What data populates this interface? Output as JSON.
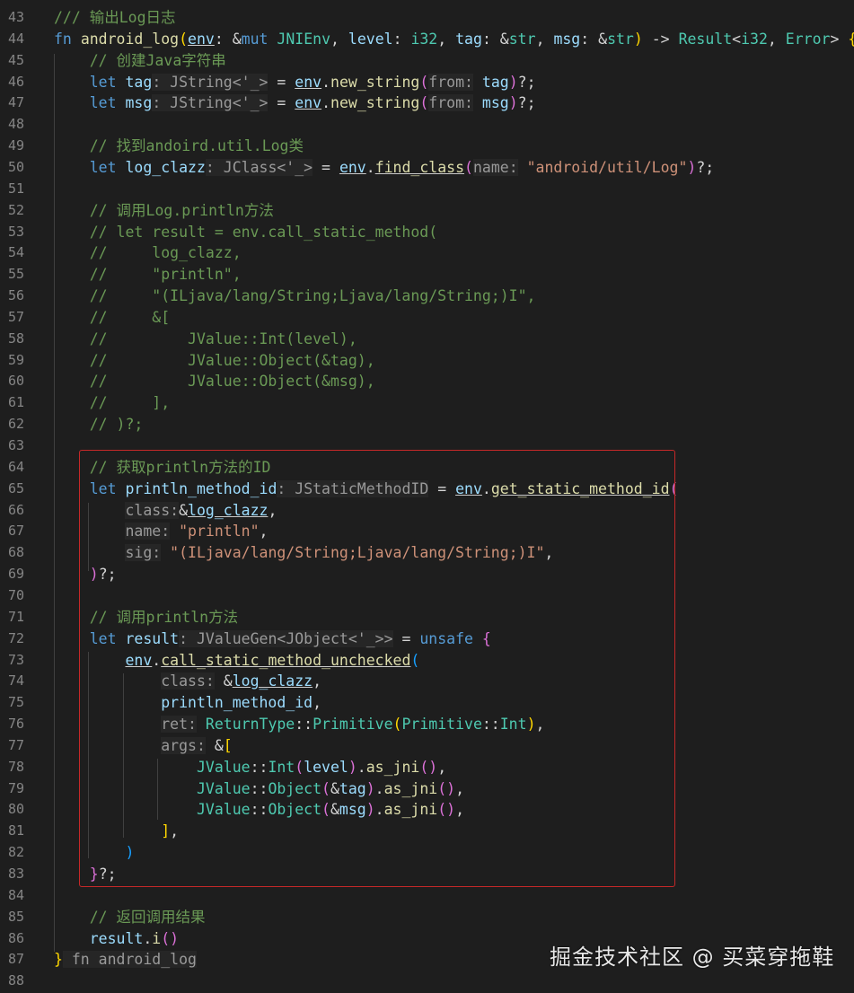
{
  "editor": {
    "lines": [
      {
        "n": "43",
        "parts": [
          [
            "cm",
            "/// 输出Log日志"
          ]
        ]
      },
      {
        "n": "44",
        "parts": [
          [
            "kw",
            "fn "
          ],
          [
            "fn",
            "android_log"
          ],
          [
            "br1",
            "("
          ],
          [
            "vr ul",
            "env"
          ],
          [
            "",
            ": &"
          ],
          [
            "kw",
            "mut "
          ],
          [
            "ty",
            "JNIEnv"
          ],
          [
            "",
            ", "
          ],
          [
            "vr",
            "level"
          ],
          [
            "",
            ": "
          ],
          [
            "ty",
            "i32"
          ],
          [
            "",
            ", "
          ],
          [
            "vr",
            "tag"
          ],
          [
            "",
            ": &"
          ],
          [
            "ty",
            "str"
          ],
          [
            "",
            ", "
          ],
          [
            "vr",
            "msg"
          ],
          [
            "",
            ": &"
          ],
          [
            "ty",
            "str"
          ],
          [
            "br1",
            ")"
          ],
          [
            "",
            " -> "
          ],
          [
            "ty",
            "Result"
          ],
          [
            "",
            "<"
          ],
          [
            "ty",
            "i32"
          ],
          [
            "",
            ", "
          ],
          [
            "ty",
            "Error"
          ],
          [
            "",
            "> "
          ],
          [
            "br1",
            "{"
          ]
        ]
      },
      {
        "n": "45",
        "parts": [
          [
            "",
            "    "
          ],
          [
            "cm",
            "// 创建Java字符串"
          ]
        ]
      },
      {
        "n": "46",
        "parts": [
          [
            "",
            "    "
          ],
          [
            "kw",
            "let "
          ],
          [
            "vr",
            "tag"
          ],
          [
            "hint",
            ": JString<'_>"
          ],
          [
            "",
            " = "
          ],
          [
            "vr ul",
            "env"
          ],
          [
            "",
            "."
          ],
          [
            "fn",
            "new_string"
          ],
          [
            "br2",
            "("
          ],
          [
            "hint",
            "from:"
          ],
          [
            "",
            " "
          ],
          [
            "vr",
            "tag"
          ],
          [
            "br2",
            ")"
          ],
          [
            "",
            "?;"
          ]
        ]
      },
      {
        "n": "47",
        "parts": [
          [
            "",
            "    "
          ],
          [
            "kw",
            "let "
          ],
          [
            "vr",
            "msg"
          ],
          [
            "hint",
            ": JString<'_>"
          ],
          [
            "",
            " = "
          ],
          [
            "vr ul",
            "env"
          ],
          [
            "",
            "."
          ],
          [
            "fn",
            "new_string"
          ],
          [
            "br2",
            "("
          ],
          [
            "hint",
            "from:"
          ],
          [
            "",
            " "
          ],
          [
            "vr",
            "msg"
          ],
          [
            "br2",
            ")"
          ],
          [
            "",
            "?;"
          ]
        ]
      },
      {
        "n": "48",
        "parts": []
      },
      {
        "n": "49",
        "parts": [
          [
            "",
            "    "
          ],
          [
            "cm",
            "// 找到andoird.util.Log类"
          ]
        ]
      },
      {
        "n": "50",
        "parts": [
          [
            "",
            "    "
          ],
          [
            "kw",
            "let "
          ],
          [
            "vr",
            "log_clazz"
          ],
          [
            "hint",
            ": JClass<'_>"
          ],
          [
            "",
            " = "
          ],
          [
            "vr ul",
            "env"
          ],
          [
            "",
            "."
          ],
          [
            "fn ul",
            "find_class"
          ],
          [
            "br2",
            "("
          ],
          [
            "hint",
            "name:"
          ],
          [
            "",
            " "
          ],
          [
            "st",
            "\"android/util/Log\""
          ],
          [
            "br2",
            ")"
          ],
          [
            "",
            "?;"
          ]
        ]
      },
      {
        "n": "51",
        "parts": []
      },
      {
        "n": "52",
        "parts": [
          [
            "",
            "    "
          ],
          [
            "cm",
            "// 调用Log.println方法"
          ]
        ]
      },
      {
        "n": "53",
        "parts": [
          [
            "",
            "    "
          ],
          [
            "cm",
            "// let result = env.call_static_method("
          ]
        ]
      },
      {
        "n": "54",
        "parts": [
          [
            "",
            "    "
          ],
          [
            "cm",
            "//     log_clazz,"
          ]
        ]
      },
      {
        "n": "55",
        "parts": [
          [
            "",
            "    "
          ],
          [
            "cm",
            "//     \"println\","
          ]
        ]
      },
      {
        "n": "56",
        "parts": [
          [
            "",
            "    "
          ],
          [
            "cm",
            "//     \"(ILjava/lang/String;Ljava/lang/String;)I\","
          ]
        ]
      },
      {
        "n": "57",
        "parts": [
          [
            "",
            "    "
          ],
          [
            "cm",
            "//     &["
          ]
        ]
      },
      {
        "n": "58",
        "parts": [
          [
            "",
            "    "
          ],
          [
            "cm",
            "//         JValue::Int(level),"
          ]
        ]
      },
      {
        "n": "59",
        "parts": [
          [
            "",
            "    "
          ],
          [
            "cm",
            "//         JValue::Object(&tag),"
          ]
        ]
      },
      {
        "n": "60",
        "parts": [
          [
            "",
            "    "
          ],
          [
            "cm",
            "//         JValue::Object(&msg),"
          ]
        ]
      },
      {
        "n": "61",
        "parts": [
          [
            "",
            "    "
          ],
          [
            "cm",
            "//     ],"
          ]
        ]
      },
      {
        "n": "62",
        "parts": [
          [
            "",
            "    "
          ],
          [
            "cm",
            "// )?;"
          ]
        ]
      },
      {
        "n": "63",
        "parts": []
      },
      {
        "n": "64",
        "parts": [
          [
            "",
            "    "
          ],
          [
            "cm",
            "// 获取println方法的ID"
          ]
        ]
      },
      {
        "n": "65",
        "parts": [
          [
            "",
            "    "
          ],
          [
            "kw",
            "let "
          ],
          [
            "vr",
            "println_method_id"
          ],
          [
            "hint",
            ": JStaticMethodID"
          ],
          [
            "",
            " = "
          ],
          [
            "vr ul",
            "env"
          ],
          [
            "",
            "."
          ],
          [
            "fn ul",
            "get_static_method_id"
          ],
          [
            "br2",
            "("
          ]
        ]
      },
      {
        "n": "66",
        "parts": [
          [
            "",
            "        "
          ],
          [
            "hint",
            "class:"
          ],
          [
            "",
            "&"
          ],
          [
            "vr ul",
            "log_clazz"
          ],
          [
            "",
            ","
          ]
        ]
      },
      {
        "n": "67",
        "parts": [
          [
            "",
            "        "
          ],
          [
            "hint",
            "name:"
          ],
          [
            "",
            " "
          ],
          [
            "st",
            "\"println\""
          ],
          [
            "",
            ","
          ]
        ]
      },
      {
        "n": "68",
        "parts": [
          [
            "",
            "        "
          ],
          [
            "hint",
            "sig:"
          ],
          [
            "",
            " "
          ],
          [
            "st",
            "\"(ILjava/lang/String;Ljava/lang/String;)I\""
          ],
          [
            "",
            ","
          ]
        ]
      },
      {
        "n": "69",
        "parts": [
          [
            "",
            "    "
          ],
          [
            "br2",
            ")"
          ],
          [
            "",
            "?;"
          ]
        ]
      },
      {
        "n": "70",
        "parts": []
      },
      {
        "n": "71",
        "parts": [
          [
            "",
            "    "
          ],
          [
            "cm",
            "// 调用println方法"
          ]
        ]
      },
      {
        "n": "72",
        "parts": [
          [
            "",
            "    "
          ],
          [
            "kw",
            "let "
          ],
          [
            "vr",
            "result"
          ],
          [
            "hint",
            ": JValueGen<JObject<'_>>"
          ],
          [
            "",
            " = "
          ],
          [
            "kw",
            "unsafe "
          ],
          [
            "br2",
            "{"
          ]
        ]
      },
      {
        "n": "73",
        "parts": [
          [
            "",
            "        "
          ],
          [
            "vr ul",
            "env"
          ],
          [
            "",
            "."
          ],
          [
            "fn ul",
            "call_static_method_unchecked"
          ],
          [
            "br3",
            "("
          ]
        ]
      },
      {
        "n": "74",
        "parts": [
          [
            "",
            "            "
          ],
          [
            "hint",
            "class:"
          ],
          [
            "",
            " &"
          ],
          [
            "vr ul",
            "log_clazz"
          ],
          [
            "",
            ","
          ]
        ]
      },
      {
        "n": "75",
        "parts": [
          [
            "",
            "            "
          ],
          [
            "vr",
            "println_method_id"
          ],
          [
            "",
            ","
          ]
        ]
      },
      {
        "n": "76",
        "parts": [
          [
            "",
            "            "
          ],
          [
            "hint",
            "ret:"
          ],
          [
            "",
            " "
          ],
          [
            "ty",
            "ReturnType"
          ],
          [
            "",
            "::"
          ],
          [
            "ty",
            "Primitive"
          ],
          [
            "br1",
            "("
          ],
          [
            "ty",
            "Primitive"
          ],
          [
            "",
            "::"
          ],
          [
            "ty",
            "Int"
          ],
          [
            "br1",
            ")"
          ],
          [
            "",
            ","
          ]
        ]
      },
      {
        "n": "77",
        "parts": [
          [
            "",
            "            "
          ],
          [
            "hint",
            "args:"
          ],
          [
            "",
            " &"
          ],
          [
            "br1",
            "["
          ]
        ]
      },
      {
        "n": "78",
        "parts": [
          [
            "",
            "                "
          ],
          [
            "ty",
            "JValue"
          ],
          [
            "",
            "::"
          ],
          [
            "ty",
            "Int"
          ],
          [
            "br2",
            "("
          ],
          [
            "vr",
            "level"
          ],
          [
            "br2",
            ")"
          ],
          [
            "",
            "."
          ],
          [
            "fn",
            "as_jni"
          ],
          [
            "br2",
            "()"
          ],
          [
            "",
            ","
          ]
        ]
      },
      {
        "n": "79",
        "parts": [
          [
            "",
            "                "
          ],
          [
            "ty",
            "JValue"
          ],
          [
            "",
            "::"
          ],
          [
            "ty",
            "Object"
          ],
          [
            "br2",
            "("
          ],
          [
            "",
            "&"
          ],
          [
            "vr",
            "tag"
          ],
          [
            "br2",
            ")"
          ],
          [
            "",
            "."
          ],
          [
            "fn",
            "as_jni"
          ],
          [
            "br2",
            "()"
          ],
          [
            "",
            ","
          ]
        ]
      },
      {
        "n": "80",
        "parts": [
          [
            "",
            "                "
          ],
          [
            "ty",
            "JValue"
          ],
          [
            "",
            "::"
          ],
          [
            "ty",
            "Object"
          ],
          [
            "br2",
            "("
          ],
          [
            "",
            "&"
          ],
          [
            "vr",
            "msg"
          ],
          [
            "br2",
            ")"
          ],
          [
            "",
            "."
          ],
          [
            "fn",
            "as_jni"
          ],
          [
            "br2",
            "()"
          ],
          [
            "",
            ","
          ]
        ]
      },
      {
        "n": "81",
        "parts": [
          [
            "",
            "            "
          ],
          [
            "br1",
            "]"
          ],
          [
            "",
            ","
          ]
        ]
      },
      {
        "n": "82",
        "parts": [
          [
            "",
            "        "
          ],
          [
            "br3",
            ")"
          ]
        ]
      },
      {
        "n": "83",
        "parts": [
          [
            "",
            "    "
          ],
          [
            "br2",
            "}"
          ],
          [
            "",
            "?;"
          ]
        ]
      },
      {
        "n": "84",
        "parts": []
      },
      {
        "n": "85",
        "parts": [
          [
            "",
            "    "
          ],
          [
            "cm",
            "// 返回调用结果"
          ]
        ]
      },
      {
        "n": "86",
        "parts": [
          [
            "",
            "    "
          ],
          [
            "vr",
            "result"
          ],
          [
            "",
            "."
          ],
          [
            "fn",
            "i"
          ],
          [
            "br2",
            "()"
          ]
        ]
      },
      {
        "n": "87",
        "parts": [
          [
            "br1",
            "}"
          ],
          [
            "hint",
            " fn android_log"
          ]
        ]
      },
      {
        "n": "88",
        "parts": []
      }
    ]
  },
  "watermark": {
    "text": "掘金技术社区 @ 买菜穿拖鞋"
  }
}
